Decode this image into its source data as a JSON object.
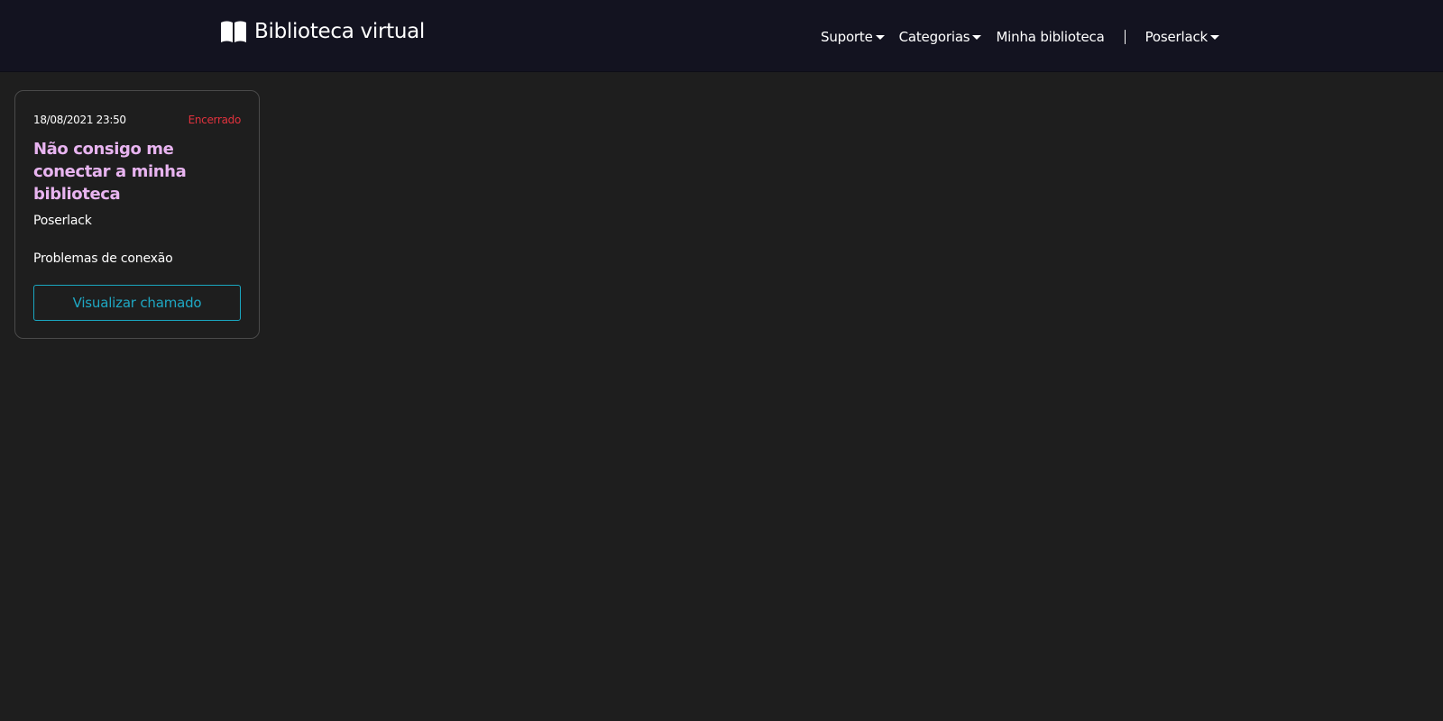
{
  "navbar": {
    "brand": {
      "icon": "open-book-icon",
      "title": "Biblioteca virtual"
    },
    "items": [
      {
        "label": "Suporte",
        "dropdown": true
      },
      {
        "label": "Categorias",
        "dropdown": true
      },
      {
        "label": "Minha biblioteca",
        "dropdown": false
      }
    ],
    "user": {
      "label": "Poserlack",
      "dropdown": true
    }
  },
  "tickets": [
    {
      "date": "18/08/2021 23:50",
      "status": "Encerrado",
      "title": "Não consigo me conectar a minha biblioteca",
      "author": "Poserlack",
      "category": "Problemas de conexão",
      "button_label": "Visualizar chamado"
    }
  ],
  "colors": {
    "background": "#1e1e1e",
    "navbar": "#131320",
    "title_accent": "#e8b4f0",
    "status_closed": "#e0323d",
    "button_outline": "#1aa6c0"
  }
}
